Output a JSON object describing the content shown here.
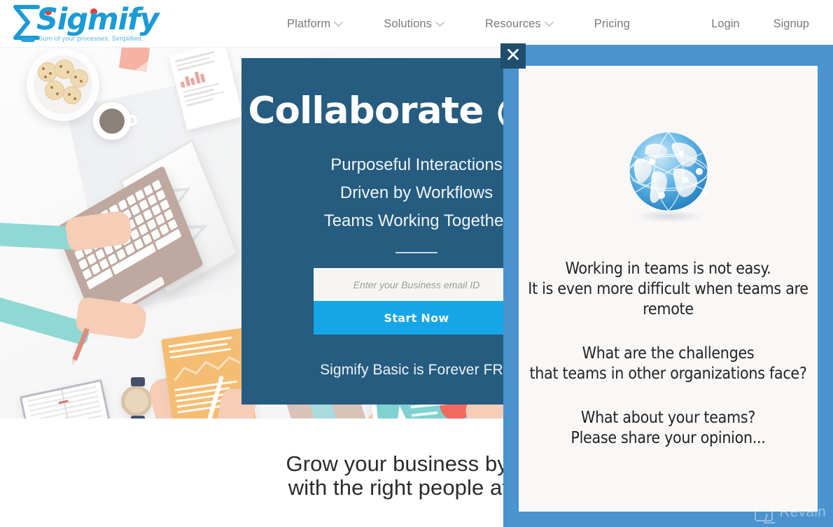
{
  "brand": {
    "name": "Sigmify",
    "tagline": "Sum of your processes. Simplified.",
    "logo_icon": "sigma-icon",
    "color": "#1B9AD6"
  },
  "nav": {
    "items": [
      {
        "label": "Platform",
        "has_dropdown": true
      },
      {
        "label": "Solutions",
        "has_dropdown": true
      },
      {
        "label": "Resources",
        "has_dropdown": true
      },
      {
        "label": "Pricing",
        "has_dropdown": false
      }
    ],
    "login_label": "Login",
    "signup_label": "Signup"
  },
  "hero": {
    "title": "Collaborate @ W",
    "subtitles": [
      "Purposeful Interactions",
      "Driven by Workflows",
      "Teams Working Together"
    ],
    "email_placeholder": "Enter your Business email ID",
    "email_value": "",
    "cta_label": "Start Now",
    "free_note": "Sigmify Basic is Forever FRE",
    "panel_color": "#255c80",
    "cta_color": "#16a6e8"
  },
  "section": {
    "heading_line1": "Grow your business by coll",
    "heading_line2": "with the right people at the"
  },
  "modal": {
    "close_label": "✕",
    "image_icon": "globe-network-icon",
    "blocks": [
      "Working in teams is not easy.\nIt is even more difficult when teams are remote",
      "What are the challenges\nthat teams in other organizations face?",
      "What about your teams?\nPlease share your opinion..."
    ],
    "line1a": "Working in teams is not easy.",
    "line1b": "It is even more difficult when teams are remote",
    "line2a": "What are the challenges",
    "line2b": "that teams in other organizations face?",
    "line3a": "What about your teams?",
    "line3b": "Please share your opinion...",
    "frame_color": "#4a93ce",
    "panel_color": "#faf8f7"
  },
  "watermark": {
    "text": "Revain",
    "icon": "revain-logo-icon"
  }
}
